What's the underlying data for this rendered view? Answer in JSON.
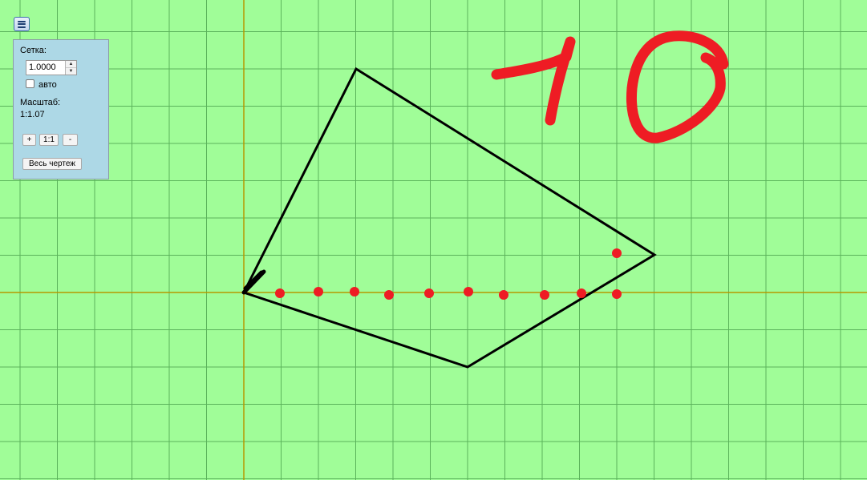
{
  "menu": {
    "icon": "hamburger-menu-icon"
  },
  "panel": {
    "grid_label": "Сетка:",
    "grid_value": "1.0000",
    "auto_label": "авто",
    "auto_checked": false,
    "scale_label": "Масштаб:",
    "scale_value": "1:1.07",
    "zoom_in_label": "+",
    "zoom_reset_label": "1:1",
    "zoom_out_label": "-",
    "fit_drawing_label": "Весь чертеж"
  },
  "handwriting_text": "10",
  "colors": {
    "background": "#a0fd98",
    "grid": "#5bb35b",
    "axes": "#b59a00",
    "polygon": "#000000",
    "ink": "#ee1c24"
  }
}
